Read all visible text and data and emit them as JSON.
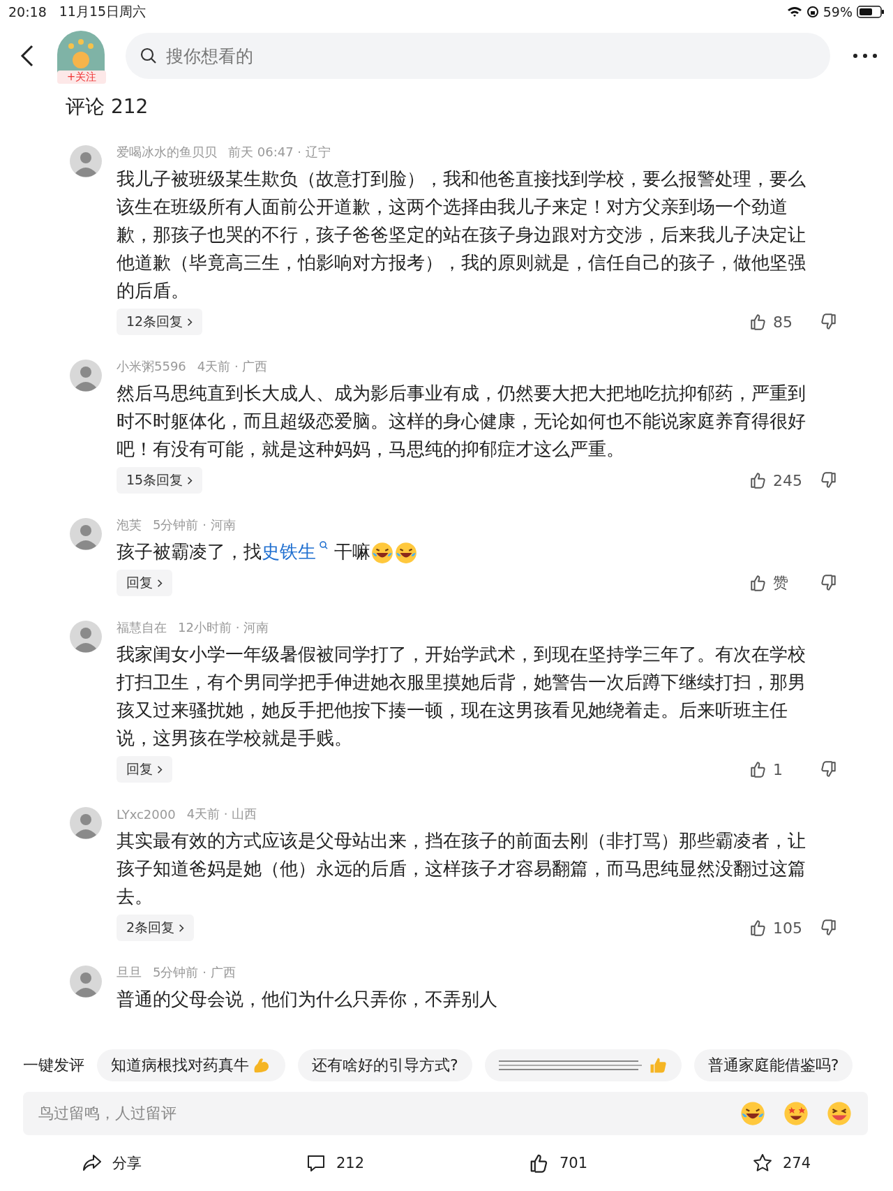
{
  "status_bar": {
    "time": "20:18",
    "date": "11月15日周六",
    "battery": "59%"
  },
  "header": {
    "follow": "+关注",
    "search": {
      "placeholder": "搜你想看的"
    }
  },
  "comments_title": "评论 212",
  "comments": [
    {
      "user": "爱喝冰水的鱼贝贝",
      "time": "前天 06:47 · 辽宁",
      "content": [
        {
          "kind": "text",
          "text": "我儿子被班级某生欺负（故意打到脸），我和他爸直接找到学校，要么报警处理，要么该生在班级所有人面前公开道歉，这两个选择由我儿子来定！对方父亲到场一个劲道歉，那孩子也哭的不行，孩子爸爸坚定的站在孩子身边跟对方交涉，后来我儿子决定让他道歉（毕竟高三生，怕影响对方报考），我的原则就是，信任自己的孩子，做他坚强的后盾。"
        }
      ],
      "replies": "12条回复",
      "likes": "85"
    },
    {
      "user": "小米粥5596",
      "time": "4天前 · 广西",
      "content": [
        {
          "kind": "text",
          "text": "然后马思纯直到长大成人、成为影后事业有成，仍然要大把大把地吃抗抑郁药，严重到时不时躯体化，而且超级恋爱脑。这样的身心健康，无论如何也不能说家庭养育得很好吧！有没有可能，就是这种妈妈，马思纯的抑郁症才这么严重。"
        }
      ],
      "replies": "15条回复",
      "likes": "245"
    },
    {
      "user": "泡芙",
      "time": "5分钟前 · 河南",
      "content": [
        {
          "kind": "text",
          "text": "孩子被霸凌了，找"
        },
        {
          "kind": "link",
          "text": "史铁生"
        },
        {
          "kind": "text",
          "text": "干嘛"
        },
        {
          "kind": "emoji"
        },
        {
          "kind": "emoji"
        }
      ],
      "replies": "回复",
      "likes": "赞"
    },
    {
      "user": "福慧自在",
      "time": "12小时前 · 河南",
      "content": [
        {
          "kind": "text",
          "text": "我家闺女小学一年级暑假被同学打了，开始学武术，到现在坚持学三年了。有次在学校打扫卫生，有个男同学把手伸进她衣服里摸她后背，她警告一次后蹲下继续打扫，那男孩又过来骚扰她，她反手把他按下揍一顿，现在这男孩看见她绕着走。后来听班主任说，这男孩在学校就是手贱。"
        }
      ],
      "replies": "回复",
      "likes": "1"
    },
    {
      "user": "LYxc2000",
      "time": "4天前 · 山西",
      "content": [
        {
          "kind": "text",
          "text": "其实最有效的方式应该是父母站出来，挡在孩子的前面去刚（非打骂）那些霸凌者，让孩子知道爸妈是她（他）永远的后盾，这样孩子才容易翻篇，而马思纯显然没翻过这篇去。"
        }
      ],
      "replies": "2条回复",
      "likes": "105"
    },
    {
      "user": "旦旦",
      "time": "5分钟前 · 广西",
      "content": [
        {
          "kind": "text",
          "text": "普通的父母会说，他们为什么只弄你，不弄别人"
        }
      ]
    }
  ],
  "quick_reply": {
    "label": "一键发评",
    "chips": [
      {
        "kind": "flex",
        "text": "知道病根找对药真牛"
      },
      {
        "kind": "plain",
        "text": "还有啥好的引导方式?"
      },
      {
        "kind": "blurred"
      },
      {
        "kind": "plain",
        "text": "普通家庭能借鉴吗?"
      }
    ]
  },
  "input": {
    "placeholder": "鸟过留鸣，人过留评"
  },
  "actions": [
    {
      "kind": "share",
      "label": "分享"
    },
    {
      "kind": "comment",
      "label": "212"
    },
    {
      "kind": "like",
      "label": "701"
    },
    {
      "kind": "star",
      "label": "274"
    }
  ]
}
